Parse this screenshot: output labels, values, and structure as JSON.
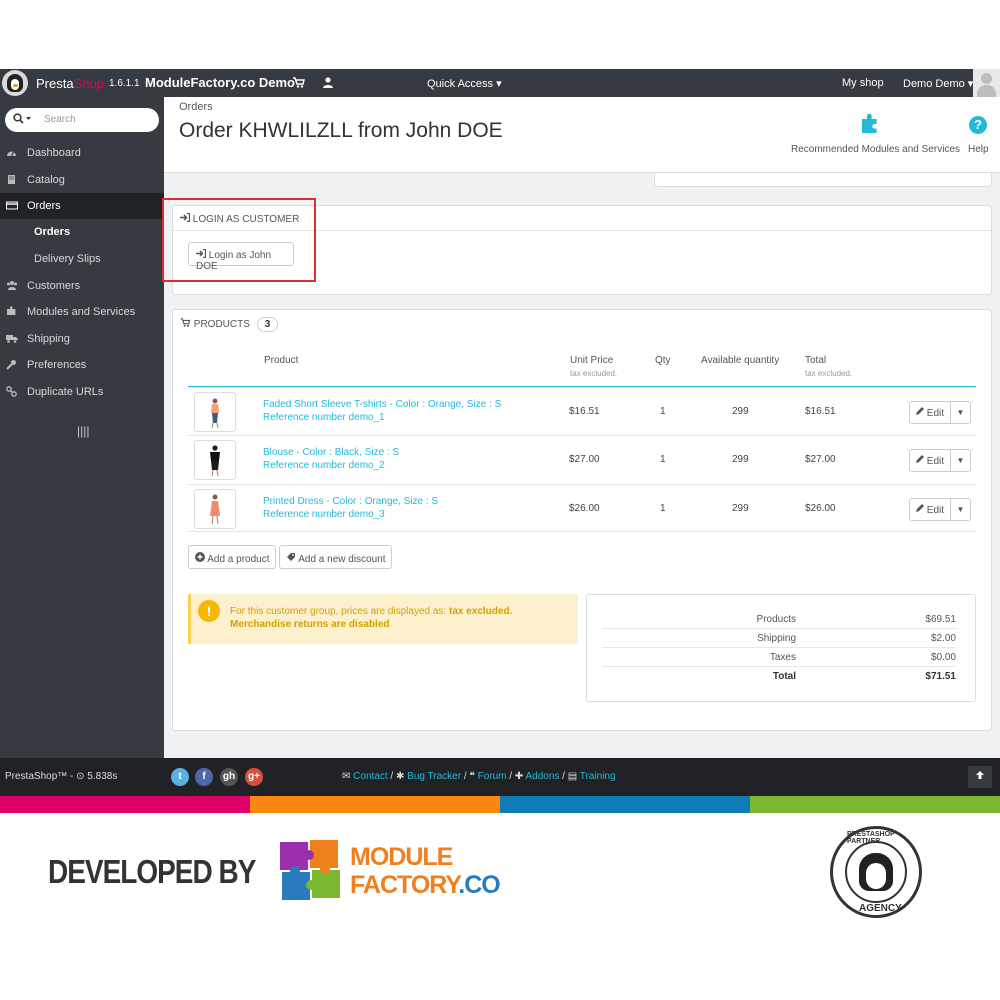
{
  "header": {
    "brand_prefix": "Presta",
    "brand_suffix": "Shop",
    "version": "1.6.1.1",
    "shop_name": "ModuleFactory.co Demo",
    "quick_access": "Quick Access ▾",
    "my_shop": "My shop",
    "account": "Demo Demo ▾"
  },
  "sidebar": {
    "search_placeholder": "Search",
    "items": [
      {
        "label": "Dashboard",
        "icon": "dashboard-icon"
      },
      {
        "label": "Catalog",
        "icon": "book-icon"
      },
      {
        "label": "Orders",
        "icon": "credit-card-icon"
      },
      {
        "label": "Customers",
        "icon": "users-icon"
      },
      {
        "label": "Modules and Services",
        "icon": "puzzle-icon"
      },
      {
        "label": "Shipping",
        "icon": "truck-icon"
      },
      {
        "label": "Preferences",
        "icon": "wrench-icon"
      },
      {
        "label": "Duplicate URLs",
        "icon": "link-icon"
      }
    ],
    "subitems": [
      {
        "label": "Orders"
      },
      {
        "label": "Delivery Slips"
      }
    ],
    "collapse_glyph": "||||"
  },
  "page": {
    "breadcrumb": "Orders",
    "title": "Order KHWLILZLL from John DOE",
    "toolbar": {
      "recommended": "Recommended Modules and Services",
      "help": "Help"
    }
  },
  "login_panel": {
    "heading": "LOGIN AS CUSTOMER",
    "button": "Login as John DOE"
  },
  "products": {
    "heading": "PRODUCTS",
    "count": "3",
    "columns": {
      "product": "Product",
      "unit_price": "Unit Price",
      "unit_price_sub": "tax excluded.",
      "qty": "Qty",
      "available": "Available quantity",
      "total": "Total",
      "total_sub": "tax excluded."
    },
    "rows": [
      {
        "name": "Faded Short Sleeve T-shirts - Color : Orange, Size : S",
        "ref": "Reference number demo_1",
        "price": "$16.51",
        "qty": "1",
        "available": "299",
        "total": "$16.51",
        "edit": "Edit"
      },
      {
        "name": "Blouse - Color : Black, Size : S",
        "ref": "Reference number demo_2",
        "price": "$27.00",
        "qty": "1",
        "available": "299",
        "total": "$27.00",
        "edit": "Edit"
      },
      {
        "name": "Printed Dress - Color : Orange, Size : S",
        "ref": "Reference number demo_3",
        "price": "$26.00",
        "qty": "1",
        "available": "299",
        "total": "$26.00",
        "edit": "Edit"
      }
    ],
    "add_product": "Add a product",
    "add_discount": "Add a new discount"
  },
  "warning": {
    "line1_prefix": "For this customer group, prices are displayed as: ",
    "line1_bold": "tax excluded.",
    "line2": "Merchandise returns are disabled"
  },
  "totals": [
    {
      "label": "Products",
      "value": "$69.51"
    },
    {
      "label": "Shipping",
      "value": "$2.00"
    },
    {
      "label": "Taxes",
      "value": "$0.00"
    },
    {
      "label": "Total",
      "value": "$71.51"
    }
  ],
  "footer": {
    "version": "PrestaShop™ - ⊙ 5.838s",
    "links": [
      "Contact",
      "Bug Tracker",
      "Forum",
      "Addons",
      "Training"
    ],
    "social": [
      "t",
      "f",
      "gh",
      "g+"
    ]
  },
  "promo": {
    "developed_by": "DEVELOPED BY",
    "logo_line1": "MODULE",
    "logo_line2a": "FACTORY",
    "logo_line2b": ".CO",
    "badge_top": "PRESTASHOP PARTNER",
    "badge_bottom": "AGENCY"
  },
  "colors": {
    "accent": "#25b9d7",
    "dark": "#363a41",
    "stripe": [
      "#df0067",
      "#f98710",
      "#0d7cb9",
      "#7cb82f"
    ]
  }
}
